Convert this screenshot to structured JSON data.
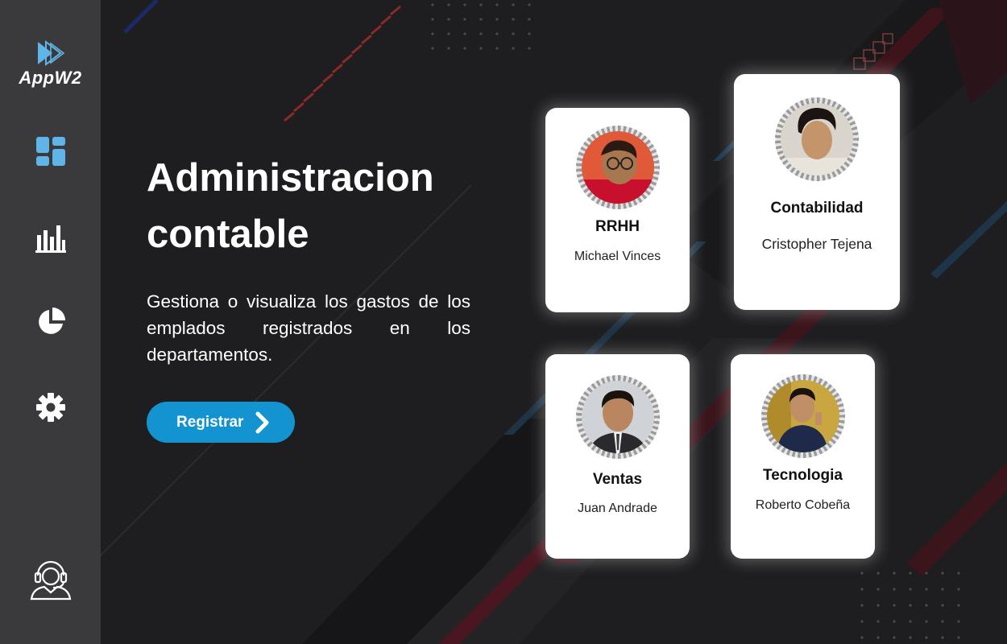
{
  "sidebar": {
    "logo_text": "AppW2",
    "nav": [
      {
        "icon": "dashboard-icon"
      },
      {
        "icon": "bar-chart-icon"
      },
      {
        "icon": "pie-chart-icon"
      },
      {
        "icon": "gear-icon"
      }
    ],
    "support_icon": "support-agent-icon"
  },
  "hero": {
    "title_line1": "Administracion",
    "title_line2": "contable",
    "description": "Gestiona o visualiza los gastos de los emplados registrados en los departamentos.",
    "button_label": "Registrar"
  },
  "cards": [
    {
      "department": "RRHH",
      "name": "Michael Vinces"
    },
    {
      "department": "Contabilidad",
      "name": "Cristopher Tejena"
    },
    {
      "department": "Ventas",
      "name": "Juan Andrade"
    },
    {
      "department": "Tecnologia",
      "name": "Roberto Cobeña"
    }
  ],
  "colors": {
    "accent": "#1493d1",
    "icon_blue": "#5fb4e8",
    "sidebar": "#3a3a3c",
    "background": "#1e1e20"
  }
}
